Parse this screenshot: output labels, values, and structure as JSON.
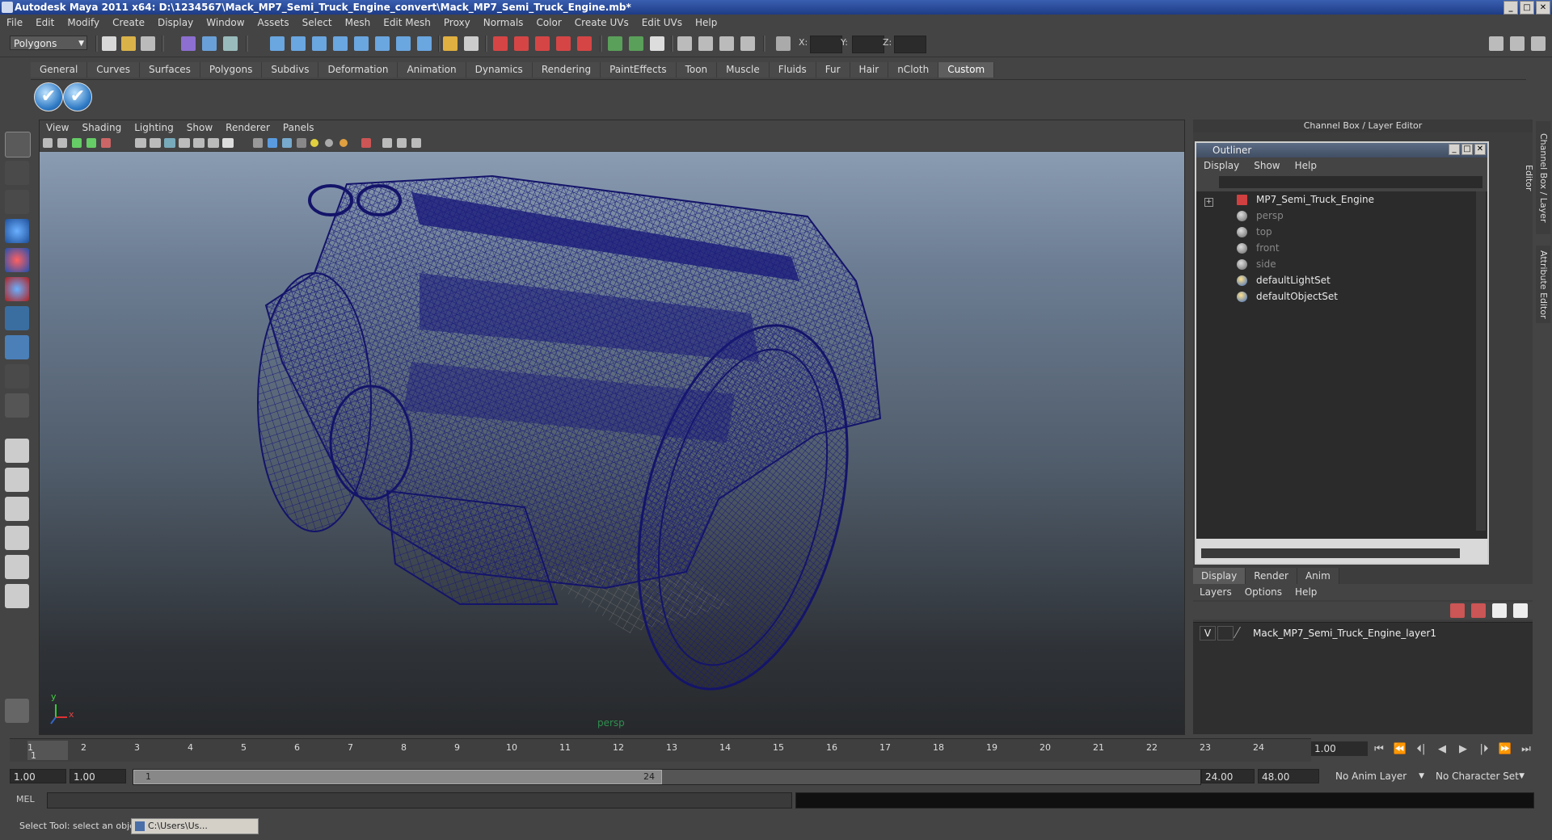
{
  "window": {
    "title": "Autodesk Maya 2011 x64: D:\\1234567\\Mack_MP7_Semi_Truck_Engine_convert\\Mack_MP7_Semi_Truck_Engine.mb*",
    "controls": [
      "_",
      "□",
      "✕"
    ]
  },
  "menubar": [
    "File",
    "Edit",
    "Modify",
    "Create",
    "Display",
    "Window",
    "Assets",
    "Select",
    "Mesh",
    "Edit Mesh",
    "Proxy",
    "Normals",
    "Color",
    "Create UVs",
    "Edit UVs",
    "Help"
  ],
  "toolbar": {
    "menuset": "Polygons",
    "coords": {
      "x": "X:",
      "y": "Y:",
      "z": "Z:"
    }
  },
  "shelf": {
    "tabs": [
      "General",
      "Curves",
      "Surfaces",
      "Polygons",
      "Subdivs",
      "Deformation",
      "Animation",
      "Dynamics",
      "Rendering",
      "PaintEffects",
      "Toon",
      "Muscle",
      "Fluids",
      "Fur",
      "Hair",
      "nCloth",
      "Custom"
    ],
    "active_tab": "Custom",
    "buttons": [
      "✔",
      "✔"
    ]
  },
  "viewport": {
    "menu": [
      "View",
      "Shading",
      "Lighting",
      "Show",
      "Renderer",
      "Panels"
    ],
    "camera_label": "persp",
    "wire_color": "#1a1a7a",
    "axis": {
      "x": "x",
      "y": "y"
    }
  },
  "channel_box": {
    "title": "Channel Box / Layer Editor"
  },
  "outliner": {
    "title": "Outliner",
    "menu": [
      "Display",
      "Show",
      "Help"
    ],
    "items": [
      {
        "label": "MP7_Semi_Truck_Engine",
        "style": "bright"
      },
      {
        "label": "persp",
        "style": "dim"
      },
      {
        "label": "top",
        "style": "dim"
      },
      {
        "label": "front",
        "style": "dim"
      },
      {
        "label": "side",
        "style": "dim"
      },
      {
        "label": "defaultLightSet",
        "style": "bright"
      },
      {
        "label": "defaultObjectSet",
        "style": "bright"
      }
    ]
  },
  "layer_editor": {
    "tabs": [
      "Display",
      "Render",
      "Anim"
    ],
    "active_tab": "Display",
    "menu": [
      "Layers",
      "Options",
      "Help"
    ],
    "layers": [
      {
        "visible": "V",
        "name": "Mack_MP7_Semi_Truck_Engine_layer1"
      }
    ]
  },
  "side_tabs": [
    "Channel Box / Layer Editor",
    "Attribute Editor"
  ],
  "timeline": {
    "ticks": [
      "1",
      "2",
      "3",
      "4",
      "5",
      "6",
      "7",
      "8",
      "9",
      "10",
      "11",
      "12",
      "13",
      "14",
      "15",
      "16",
      "17",
      "18",
      "19",
      "20",
      "21",
      "22",
      "23",
      "24"
    ],
    "current_frame": "1.00",
    "marker": "1",
    "playback": [
      "⏮",
      "⏪",
      "⏴|",
      "◀",
      "▶",
      "|⏵",
      "⏩",
      "⏭"
    ]
  },
  "range": {
    "start": "1.00",
    "playback_start": "1.00",
    "handle_left": "1",
    "handle_right": "24",
    "playback_end": "24.00",
    "end": "48.00",
    "anim_layer": "No Anim Layer",
    "char_set": "No Character Set"
  },
  "command": {
    "label": "MEL"
  },
  "help": {
    "text": "Select Tool: select an object",
    "task": "C:\\Users\\Us..."
  }
}
